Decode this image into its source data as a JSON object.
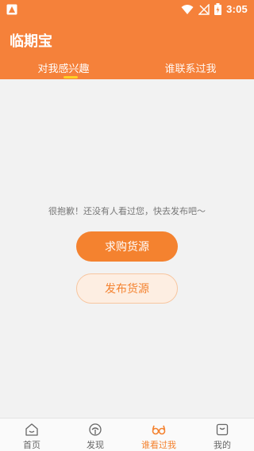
{
  "status": {
    "time": "3:05"
  },
  "app": {
    "title": "临期宝"
  },
  "tabs": [
    {
      "label": "对我感兴趣"
    },
    {
      "label": "谁联系过我"
    }
  ],
  "empty": {
    "message": "很抱歉！还没有人看过您，快去发布吧～",
    "primary_button": "求购货源",
    "secondary_button": "发布货源"
  },
  "tabbar": [
    {
      "label": "首页",
      "icon": "home-icon"
    },
    {
      "label": "发现",
      "icon": "discover-icon"
    },
    {
      "label": "谁看过我",
      "icon": "viewers-icon",
      "active": true
    },
    {
      "label": "我的",
      "icon": "profile-icon"
    }
  ],
  "colors": {
    "accent": "#f5813a",
    "indicator": "#ffcf26",
    "background": "#f2f2f2"
  }
}
